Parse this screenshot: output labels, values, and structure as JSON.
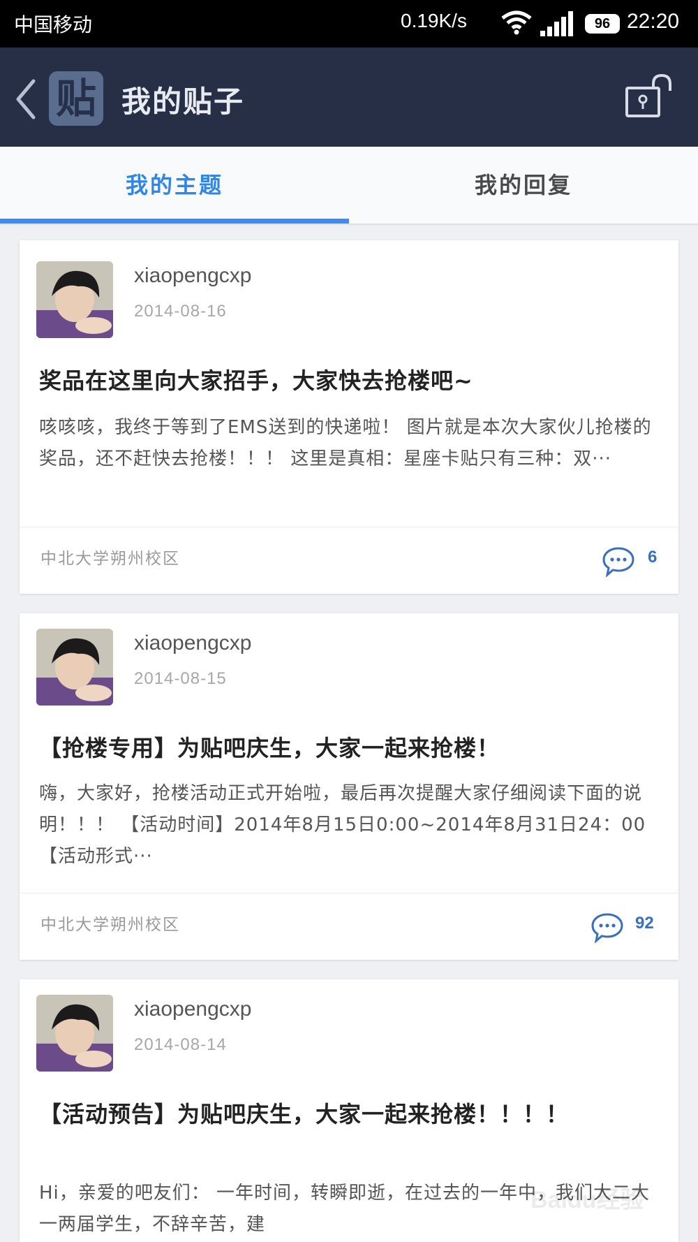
{
  "status_bar": {
    "carrier": "中国移动",
    "speed": "0.19K/s",
    "battery": "96",
    "time": "22:20"
  },
  "header": {
    "logo_char": "贴",
    "title": "我的贴子"
  },
  "tabs": [
    {
      "label": "我的主题",
      "active": true
    },
    {
      "label": "我的回复",
      "active": false
    }
  ],
  "posts": [
    {
      "username": "xiaopengcxp",
      "date": "2014-08-16",
      "title": "奖品在这里向大家招手，大家快去抢楼吧~",
      "excerpt": " 咳咳咳，我终于等到了EMS送到的快递啦！ 图片就是本次大家伙儿抢楼的奖品，还不赶快去抢楼！！！ 这里是真相：星座卡贴只有三种：双···",
      "forum": "中北大学朔州校区",
      "comments": "6"
    },
    {
      "username": "xiaopengcxp",
      "date": "2014-08-15",
      "title": "【抢楼专用】为贴吧庆生，大家一起来抢楼！",
      "excerpt": "嗨，大家好，抢楼活动正式开始啦，最后再次提醒大家仔细阅读下面的说明！！！ 【活动时间】2014年8月15日0:00~2014年8月31日24：00 【活动形式···",
      "forum": "中北大学朔州校区",
      "comments": "92"
    },
    {
      "username": "xiaopengcxp",
      "date": "2014-08-14",
      "title": "【活动预告】为贴吧庆生，大家一起来抢楼！！！！",
      "excerpt": "Hi，亲爱的吧友们： 一年时间，转瞬即逝，在过去的一年中，我们大二大一两届学生，不辞辛苦，建",
      "forum": "",
      "comments": ""
    }
  ],
  "watermark": "Baidu经验"
}
